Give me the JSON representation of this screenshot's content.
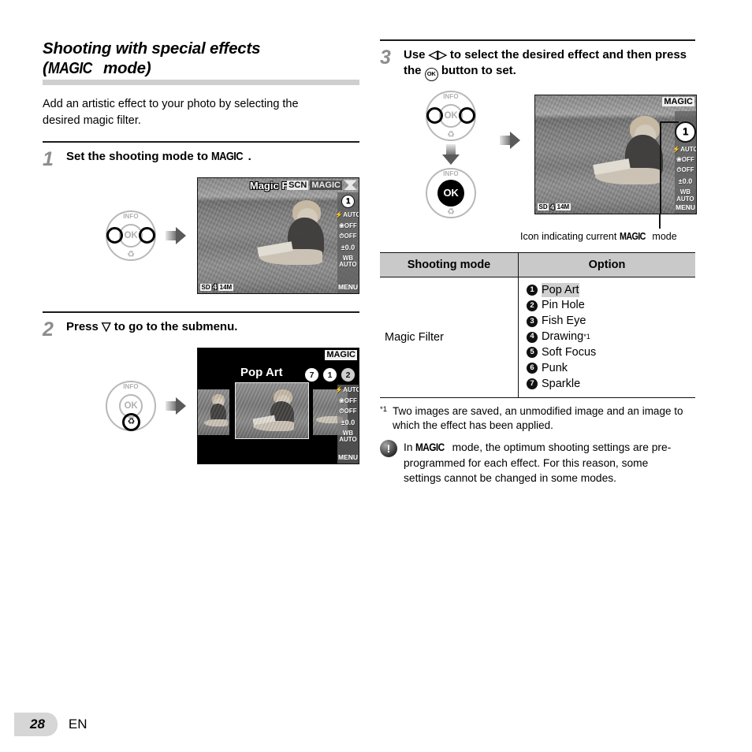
{
  "document": {
    "section_title_line1": "Shooting with special effects",
    "section_title_line2_prefix": "(",
    "section_title_magic": "MAGIC",
    "section_title_line2_suffix": " mode)",
    "intro": "Add an artistic effect to your photo by selecting the desired magic filter.",
    "page_number": "28",
    "language": "EN"
  },
  "steps": [
    {
      "number": "1",
      "text_before": "Set the shooting mode to ",
      "magic": "MAGIC",
      "text_after": ".",
      "dpad": {
        "info_label": "INFO",
        "ok_label": "OK",
        "trash_glyph": "♻",
        "highlight": "left-right"
      }
    },
    {
      "number": "2",
      "text_before": "Press ",
      "glyph": "▽",
      "text_after": " to go to the submenu.",
      "dpad": {
        "info_label": "INFO",
        "ok_label": "OK",
        "trash_glyph": "♻",
        "highlight": "down"
      }
    },
    {
      "number": "3",
      "text_before": "Use ",
      "glyph": "◁▷",
      "text_mid": " to select the desired effect and then press the ",
      "ok_glyph": "OK",
      "text_after": " button to set.",
      "dpad_top": {
        "info_label": "INFO",
        "ok_label": "OK",
        "trash_glyph": "♻",
        "highlight": "left-right"
      },
      "dpad_bottom": {
        "info_label": "INFO",
        "ok_label": "OK",
        "trash_glyph": "♻",
        "highlight": "ok"
      }
    }
  ],
  "lcd_step1": {
    "title": "Magic Filter",
    "mode_chips": [
      "SCN",
      "MAGIC"
    ],
    "status": {
      "effect_number": "1",
      "flash": "AUTO",
      "flash_symbol": "⚡",
      "macro": "OFF",
      "macro_symbol": "❀",
      "timer": "OFF",
      "timer_symbol": "⏱",
      "exposure": "±0.0",
      "wb_label": "WB",
      "wb_value": "AUTO",
      "menu": "MENU"
    },
    "bottom_left": {
      "card": "SD",
      "count": "4",
      "size": "14M"
    }
  },
  "lcd_step2": {
    "title": "Pop Art",
    "badge": "MAGIC",
    "circles": [
      "7",
      "1",
      "2"
    ],
    "selected_circle_index": 2,
    "status": {
      "flash": "AUTO",
      "macro": "OFF",
      "timer": "OFF",
      "exposure": "±0.0",
      "wb_label": "WB",
      "wb_value": "AUTO",
      "menu": "MENU"
    }
  },
  "lcd_step3": {
    "badge": "MAGIC",
    "status": {
      "effect_number": "1",
      "flash": "AUTO",
      "macro": "OFF",
      "timer": "OFF",
      "exposure": "±0.0",
      "wb_label": "WB",
      "wb_value": "AUTO",
      "menu": "MENU"
    },
    "bottom_left": {
      "card": "SD",
      "count": "4",
      "size": "14M"
    },
    "caption_before": "Icon indicating current ",
    "caption_magic": "MAGIC",
    "caption_after": " mode"
  },
  "table": {
    "headers": [
      "Shooting mode",
      "Option"
    ],
    "row_label": "Magic Filter",
    "options": [
      {
        "num": "1",
        "label": "Pop Art",
        "highlighted": true,
        "footnote": ""
      },
      {
        "num": "2",
        "label": "Pin Hole",
        "highlighted": false,
        "footnote": ""
      },
      {
        "num": "3",
        "label": "Fish Eye",
        "highlighted": false,
        "footnote": ""
      },
      {
        "num": "4",
        "label": "Drawing",
        "highlighted": false,
        "footnote": "*1"
      },
      {
        "num": "5",
        "label": "Soft Focus",
        "highlighted": false,
        "footnote": ""
      },
      {
        "num": "6",
        "label": "Punk",
        "highlighted": false,
        "footnote": ""
      },
      {
        "num": "7",
        "label": "Sparkle",
        "highlighted": false,
        "footnote": ""
      }
    ]
  },
  "footnote": {
    "mark": "*1",
    "text": "Two images are saved, an unmodified image and an image to which the effect has been applied."
  },
  "note": {
    "icon": "!",
    "text_before": "In ",
    "magic": "MAGIC",
    "text_after": " mode, the optimum shooting settings are pre-programmed for each effect. For this reason, some settings cannot be changed in some modes."
  }
}
